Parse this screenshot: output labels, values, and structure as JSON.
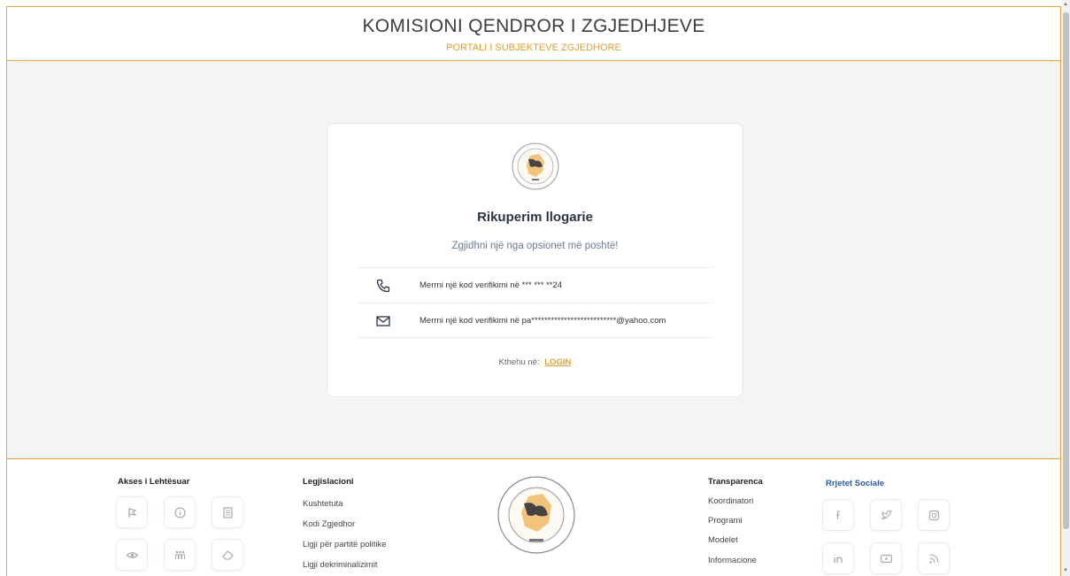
{
  "header": {
    "title": "KOMISIONI QENDROR I ZGJEDHJEVE",
    "subtitle": "PORTALI I SUBJEKTEVE ZGJEDHORE"
  },
  "card": {
    "heading": "Rikuperim llogarie",
    "subheading": "Zgjidhni një nga opsionet më poshtë!",
    "options": [
      {
        "icon": "phone-icon",
        "label": "Merrni një kod verifikimi në *** *** **24"
      },
      {
        "icon": "mail-icon",
        "label": "Merrni një kod verifikimi në pa**************************@yahoo.com"
      }
    ],
    "back_text": "Kthehu në:",
    "back_link": "LOGIN"
  },
  "footer": {
    "accessibility": {
      "title": "Akses i Lehtësuar",
      "icons": [
        "flag-icon",
        "info-icon",
        "document-icon",
        "eye-icon",
        "people-icon",
        "hand-icon"
      ]
    },
    "legislation": {
      "title": "Legjislacioni",
      "links": [
        "Kushtetuta",
        "Kodi Zgjedhor",
        "Ligji për partitë politike",
        "Ligji dekriminalizimit"
      ]
    },
    "transparency": {
      "title": "Transparenca",
      "links": [
        "Koordinatori",
        "Programi",
        "Modelet",
        "Informacione"
      ]
    },
    "social": {
      "title": "Rrjetet Sociale",
      "icons": [
        "facebook-icon",
        "twitter-icon",
        "instagram-icon",
        "linkedin-icon",
        "youtube-icon",
        "rss-icon"
      ]
    }
  },
  "colors": {
    "accent": "#e0a030",
    "heading": "#2b3445",
    "social_title": "#2b5aa8"
  }
}
